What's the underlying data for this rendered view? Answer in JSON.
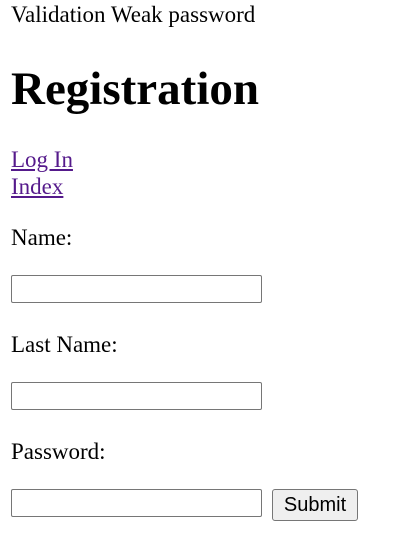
{
  "validation": {
    "message": "Validation Weak password"
  },
  "page_title": "Registration",
  "nav": {
    "login_link": "Log In",
    "index_link": "Index"
  },
  "form": {
    "name_label": "Name:",
    "name_value": "",
    "last_name_label": "Last Name:",
    "last_name_value": "",
    "password_label": "Password:",
    "password_value": "",
    "submit_label": "Submit"
  },
  "colors": {
    "link_visited": "#551a8b",
    "input_border": "#767676",
    "button_bg": "#efefef"
  }
}
